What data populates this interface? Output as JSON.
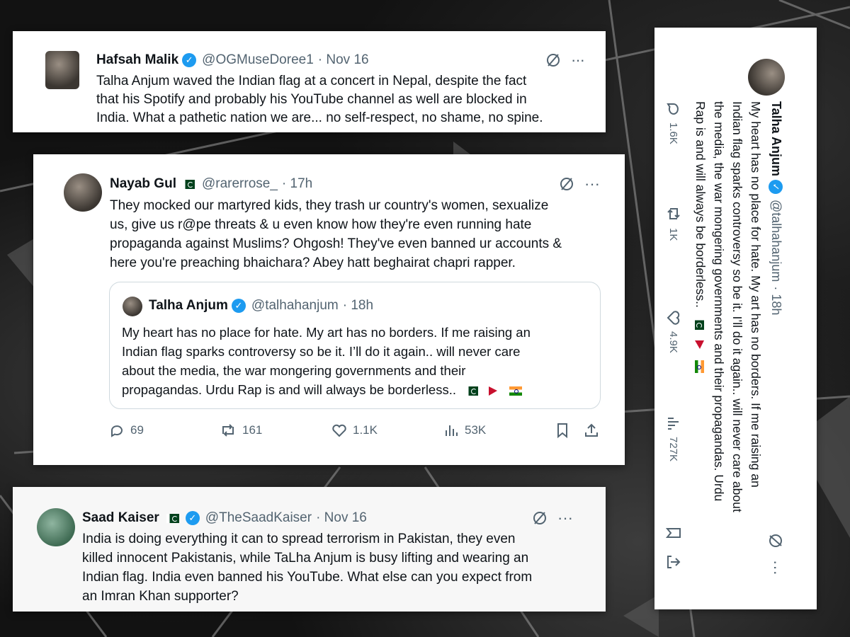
{
  "tweets": {
    "hafsah": {
      "name": "Hafsah Malik",
      "handle": "@OGMuseDoree1",
      "time": "· Nov 16",
      "lines": [
        "Talha Anjum waved the Indian flag at a concert in Nepal, despite the fact",
        "that his Spotify and probably his YouTube channel as well are blocked in",
        "India. What a pathetic nation we are... no self-respect, no shame, no spine."
      ]
    },
    "nayab": {
      "name": "Nayab Gul",
      "handle": "@rarerrose_",
      "time": "· 17h",
      "lines": [
        "They mocked our martyred kids, they trash ur country's women, sexualize",
        "us, give us r@pe threats & u even know how they're even running hate",
        "propaganda against Muslims? Ohgosh! They've even banned ur accounts &",
        "here you're preaching bhaichara? Abey hatt beghairat chapri rapper."
      ],
      "quote": {
        "name": "Talha Anjum",
        "handle": "@talhahanjum",
        "time": "· 18h",
        "lines": [
          "My heart has no place for hate. My art has no borders. If me raising an",
          "Indian flag sparks controversy so be it. I’ll do it again.. will never care",
          "about the media, the war mongering governments and their",
          "propagandas. Urdu Rap is and will always be borderless.."
        ]
      },
      "stats": {
        "replies": "69",
        "reposts": "161",
        "likes": "1.1K",
        "views": "53K"
      }
    },
    "saad": {
      "name": "Saad Kaiser",
      "handle": "@TheSaadKaiser",
      "time": "· Nov 16",
      "lines": [
        "India is doing everything it can to spread terrorism in Pakistan, they even",
        "killed innocent Pakistanis, while TaLha Anjum is busy lifting and wearing an",
        "Indian flag. India even banned his YouTube. What else can you expect from",
        "an Imran Khan supporter?"
      ]
    },
    "talha": {
      "name": "Talha Anjum",
      "handle": "@talhahanjum",
      "time": "· 18h",
      "lines": [
        "My heart has no place for hate. My art has no borders. If me raising an",
        "Indian flag sparks controversy so be it. I’ll do it again.. will never care about",
        "the media, the war mongering governments and their propagandas. Urdu",
        "Rap is and will always be borderless.."
      ],
      "stats": {
        "replies": "1.6K",
        "reposts": "1K",
        "likes": "4.9K",
        "views": "727K"
      }
    }
  },
  "icons": {
    "more": "more-icon",
    "grok": "grok-icon",
    "reply": "reply-icon",
    "repost": "repost-icon",
    "like": "like-icon",
    "views": "views-icon",
    "bookmark": "bookmark-icon",
    "share": "share-icon",
    "verified": "verified-badge-icon"
  },
  "colors": {
    "accent": "#1d9bf0",
    "text": "#0f1419",
    "muted": "#536471",
    "background": "#141414"
  }
}
